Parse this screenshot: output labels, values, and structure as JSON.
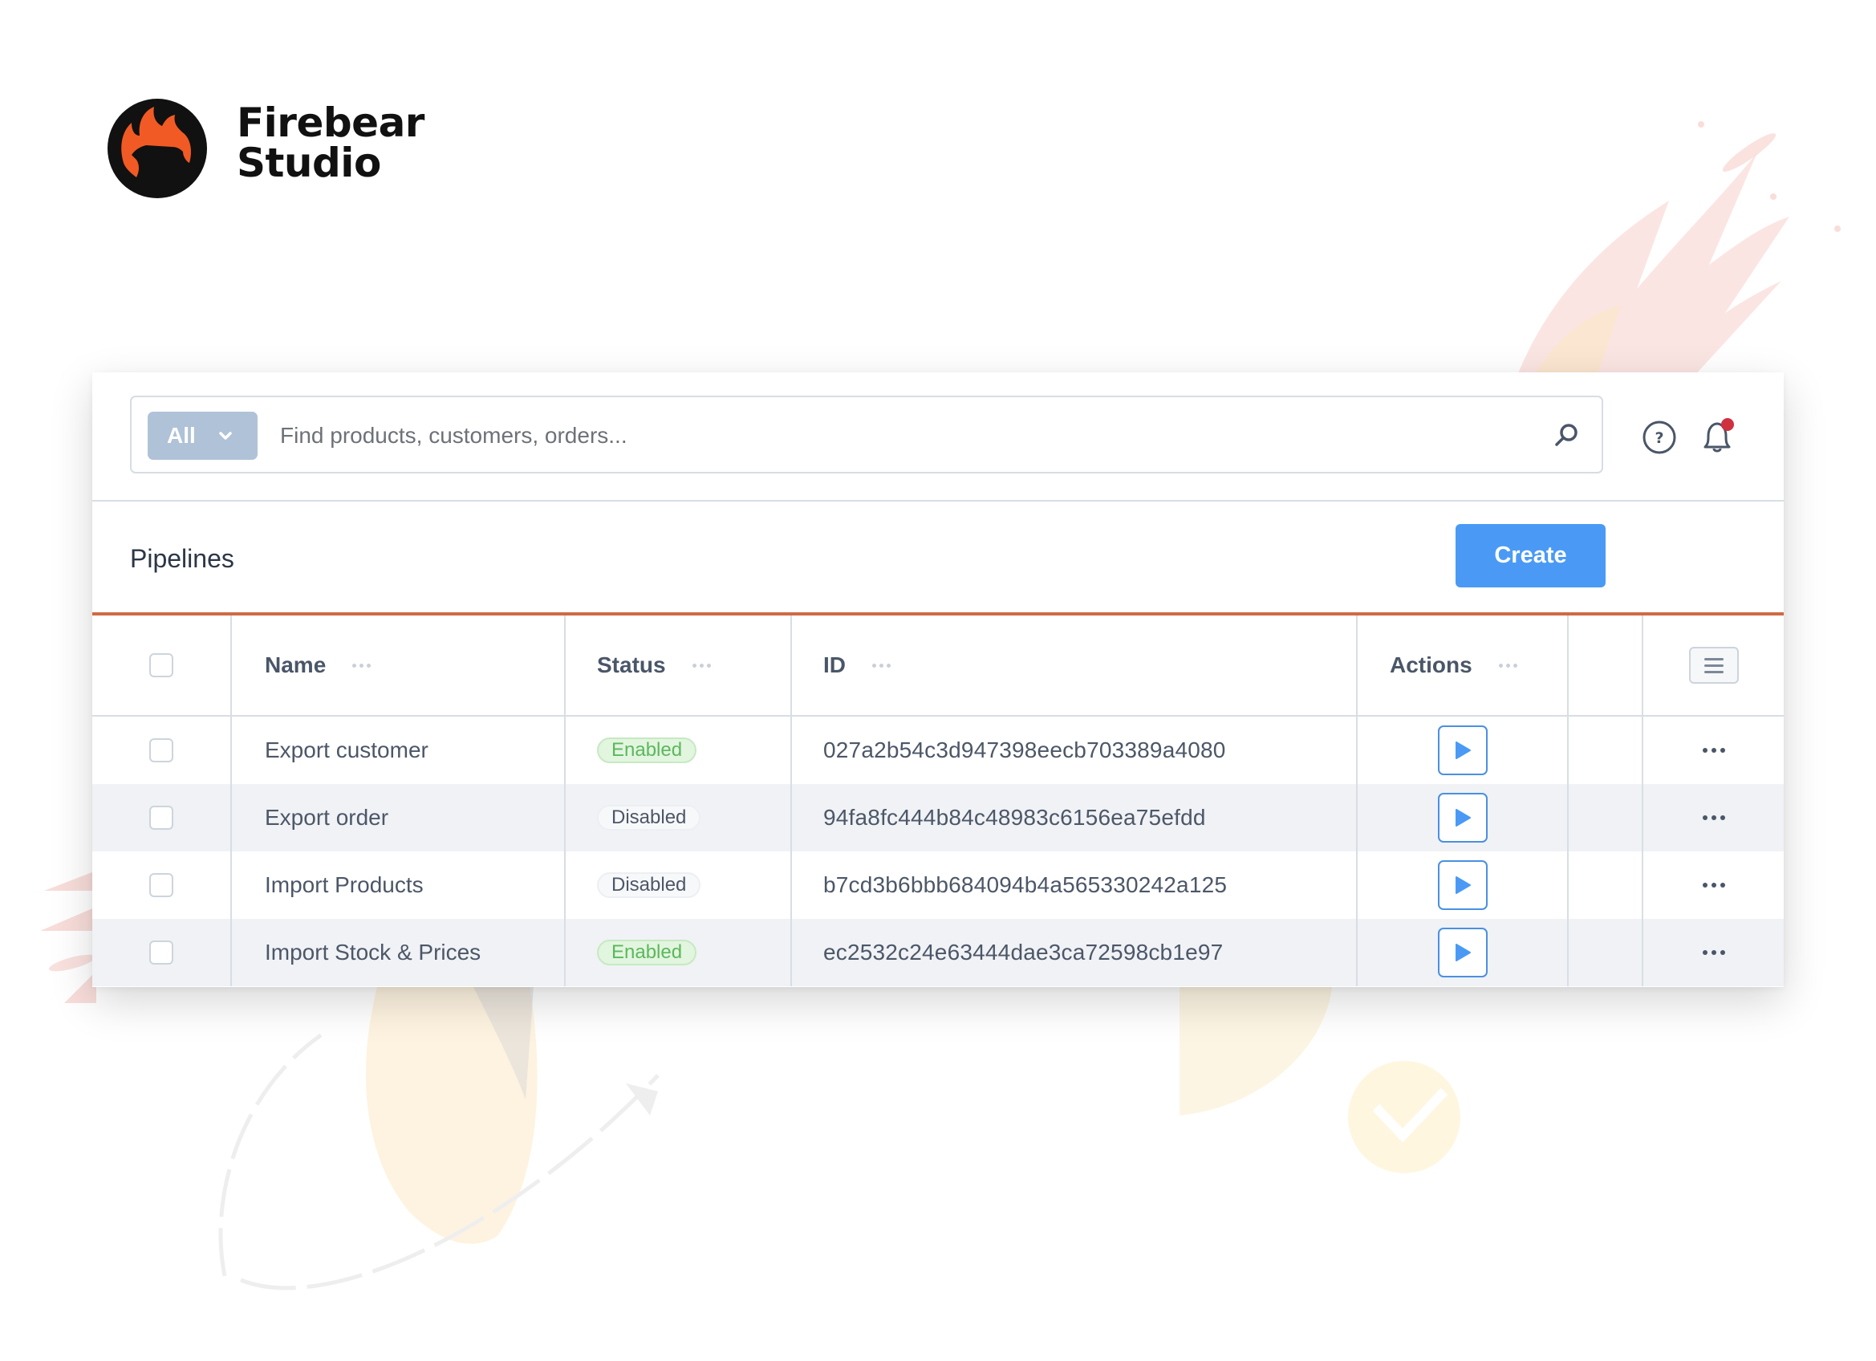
{
  "brand": {
    "line1": "Firebear",
    "line2": "Studio",
    "colors": {
      "flame": "#f15a24",
      "dark": "#111111"
    }
  },
  "search": {
    "scope_label": "All",
    "placeholder": "Find products, customers, orders...",
    "value": ""
  },
  "header_icons": {
    "search": "search-icon",
    "help": "help-circle-icon",
    "notifications": "bell-icon",
    "has_notification": true
  },
  "page": {
    "title": "Pipelines",
    "create_label": "Create"
  },
  "colors": {
    "accent_line": "#cf6a45",
    "primary": "#4a9af5",
    "scope_button": "#b0c2d8",
    "enabled_text": "#5cb85c",
    "notification_dot": "#d0313f"
  },
  "table": {
    "columns": [
      {
        "key": "name",
        "label": "Name"
      },
      {
        "key": "status",
        "label": "Status"
      },
      {
        "key": "id",
        "label": "ID"
      },
      {
        "key": "actions",
        "label": "Actions"
      }
    ],
    "rows": [
      {
        "name": "Export customer",
        "status": "Enabled",
        "id": "027a2b54c3d947398eecb703389a4080"
      },
      {
        "name": "Export order",
        "status": "Disabled",
        "id": "94fa8fc444b84c48983c6156ea75efdd"
      },
      {
        "name": "Import Products",
        "status": "Disabled",
        "id": "b7cd3b6bbb684094b4a565330242a125"
      },
      {
        "name": "Import Stock & Prices",
        "status": "Enabled",
        "id": "ec2532c24e63444dae3ca72598cb1e97"
      }
    ]
  }
}
